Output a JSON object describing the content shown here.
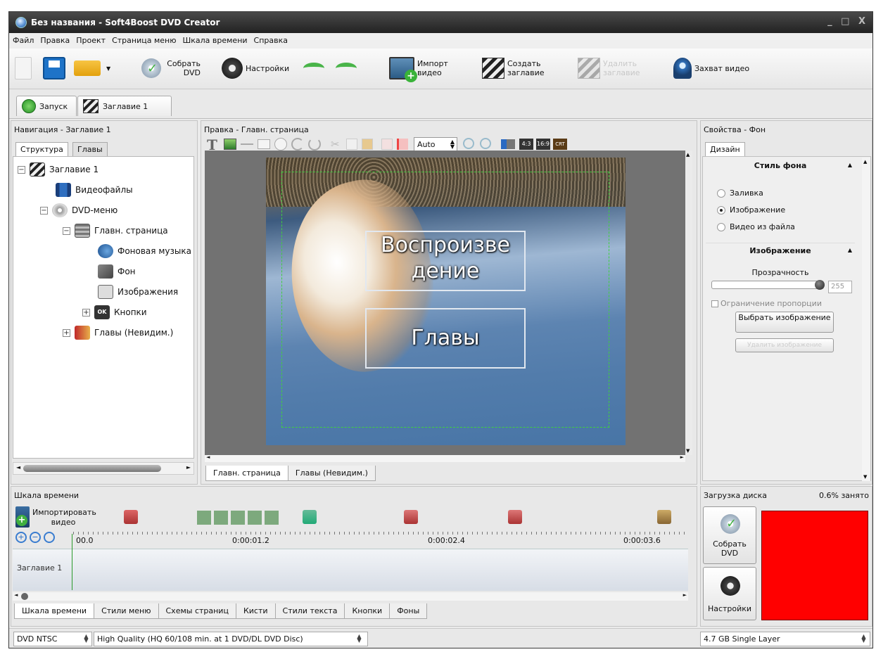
{
  "window": {
    "title": "Без названия - Soft4Boost DVD Creator",
    "controls": "_ □ X"
  },
  "menu": [
    "Файл",
    "Правка",
    "Проект",
    "Страница меню",
    "Шкала времени",
    "Справка"
  ],
  "toolbar": {
    "build_dvd": "Собрать DVD",
    "settings": "Настройки",
    "import_video": "Импорт видео",
    "create_title": "Создать заглавие",
    "delete_title": "Удалить заглавие",
    "capture_video": "Захват видео"
  },
  "top_tabs": {
    "launch": "Запуск",
    "title1": "Заглавие 1"
  },
  "navigation": {
    "header": "Навигация - Заглавие 1",
    "tabs": [
      "Структура",
      "Главы"
    ],
    "tree": [
      {
        "label": "Заглавие 1"
      },
      {
        "label": "Видеофайлы"
      },
      {
        "label": "DVD-меню"
      },
      {
        "label": "Главн. страница"
      },
      {
        "label": "Фоновая музыка"
      },
      {
        "label": "Фон"
      },
      {
        "label": "Изображения"
      },
      {
        "label": "Кнопки"
      },
      {
        "label": "Главы (Невидим.)"
      }
    ]
  },
  "editor": {
    "header": "Правка - Главн. страница",
    "zoom_value": "Auto",
    "aspect_43": "4:3",
    "aspect_169": "16:9",
    "crt": "CRT",
    "menu_buttons": [
      "Воспроизве дение",
      "Главы"
    ],
    "page_tabs": [
      "Главн. страница",
      "Главы (Невидим.)"
    ]
  },
  "properties": {
    "header": "Свойства - Фон",
    "tab": "Дизайн",
    "bg_style_title": "Стиль фона",
    "options": [
      "Заливка",
      "Изображение",
      "Видео из файла"
    ],
    "selected_option": "Изображение",
    "image_title": "Изображение",
    "transparency_label": "Прозрачность",
    "transparency_value": "255",
    "transparency_fraction": 1.0,
    "keep_ratio": "Ограничение пропорции",
    "choose_image": "Выбрать изображение",
    "remove_image": "Удалить изображение"
  },
  "timeline": {
    "header": "Шкала времени",
    "import_video": "Импортировать видео",
    "ruler": [
      "00.0",
      "0:00:01.2",
      "0:00:02.4",
      "0:00:03.6"
    ],
    "track_label": "Заглавие 1",
    "tabs": [
      "Шкала времени",
      "Стили меню",
      "Схемы страниц",
      "Кисти",
      "Стили текста",
      "Кнопки",
      "Фоны"
    ]
  },
  "disc": {
    "header": "Загрузка диска",
    "used": "0.6% занято",
    "used_fraction": 0.006,
    "build_dvd": "Собрать DVD",
    "settings": "Настройки",
    "disc_type": "4.7 GB Single Layer",
    "fill_color": "#ff0000"
  },
  "status": {
    "format": "DVD NTSC",
    "quality": "High Quality (HQ 60/108 min. at 1 DVD/DL DVD Disc)"
  }
}
